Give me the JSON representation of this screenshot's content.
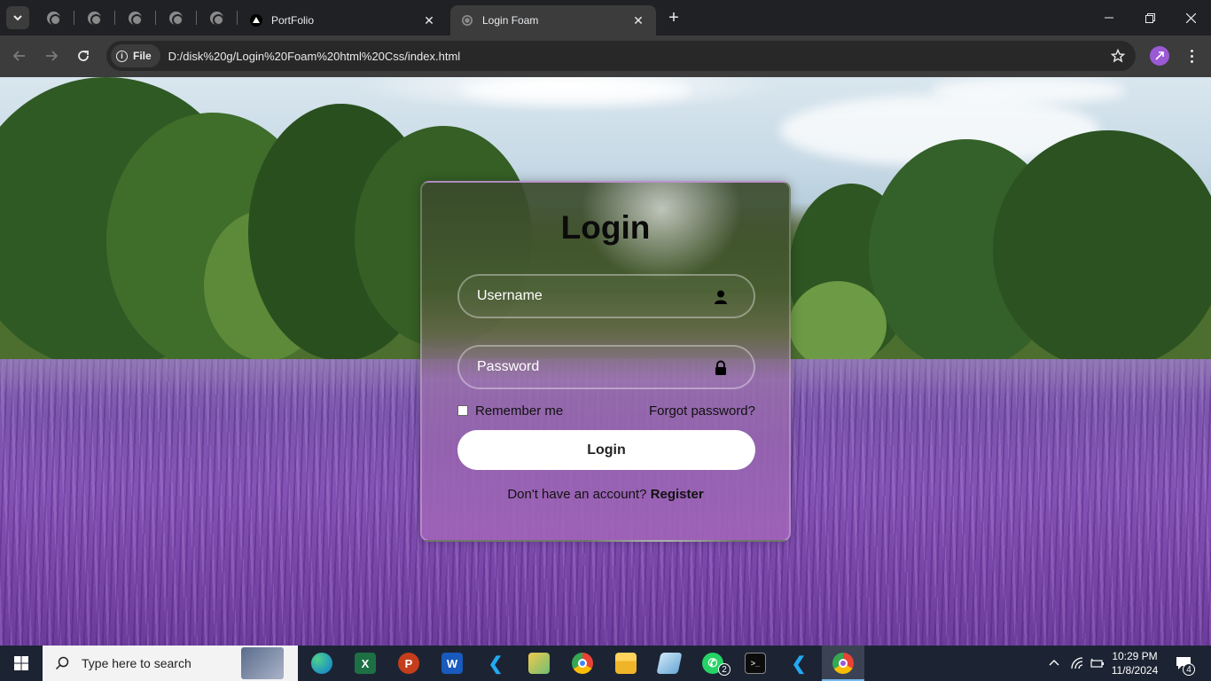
{
  "browser": {
    "tabs": [
      {
        "title": "PortFolio",
        "active": false
      },
      {
        "title": "Login Foam",
        "active": true
      }
    ],
    "new_tab_symbol": "+",
    "address_chip": "File",
    "url": "D:/disk%20g/Login%20Foam%20html%20Css/index.html"
  },
  "login": {
    "title": "Login",
    "username_placeholder": "Username",
    "password_placeholder": "Password",
    "remember_label": "Remember me",
    "forgot_label": "Forgot password?",
    "button_label": "Login",
    "register_prompt": "Don't have an account?",
    "register_link": "Register"
  },
  "taskbar": {
    "search_placeholder": "Type here to search",
    "time": "10:29 PM",
    "date": "11/8/2024",
    "whatsapp_badge": "2",
    "notification_badge": "4",
    "apps": [
      "edge-icon",
      "excel-icon",
      "powerpoint-icon",
      "word-icon",
      "vscode-icon",
      "folder-icon",
      "chrome-icon",
      "file-explorer-icon",
      "notes-icon",
      "whatsapp-icon",
      "terminal-icon",
      "vscode-icon",
      "chrome-icon"
    ]
  },
  "colors": {
    "accent": "#76b9ed",
    "card_title": "#0b0b0b",
    "button_bg": "#ffffff",
    "chrome_tab_active": "#3c3c3c"
  }
}
